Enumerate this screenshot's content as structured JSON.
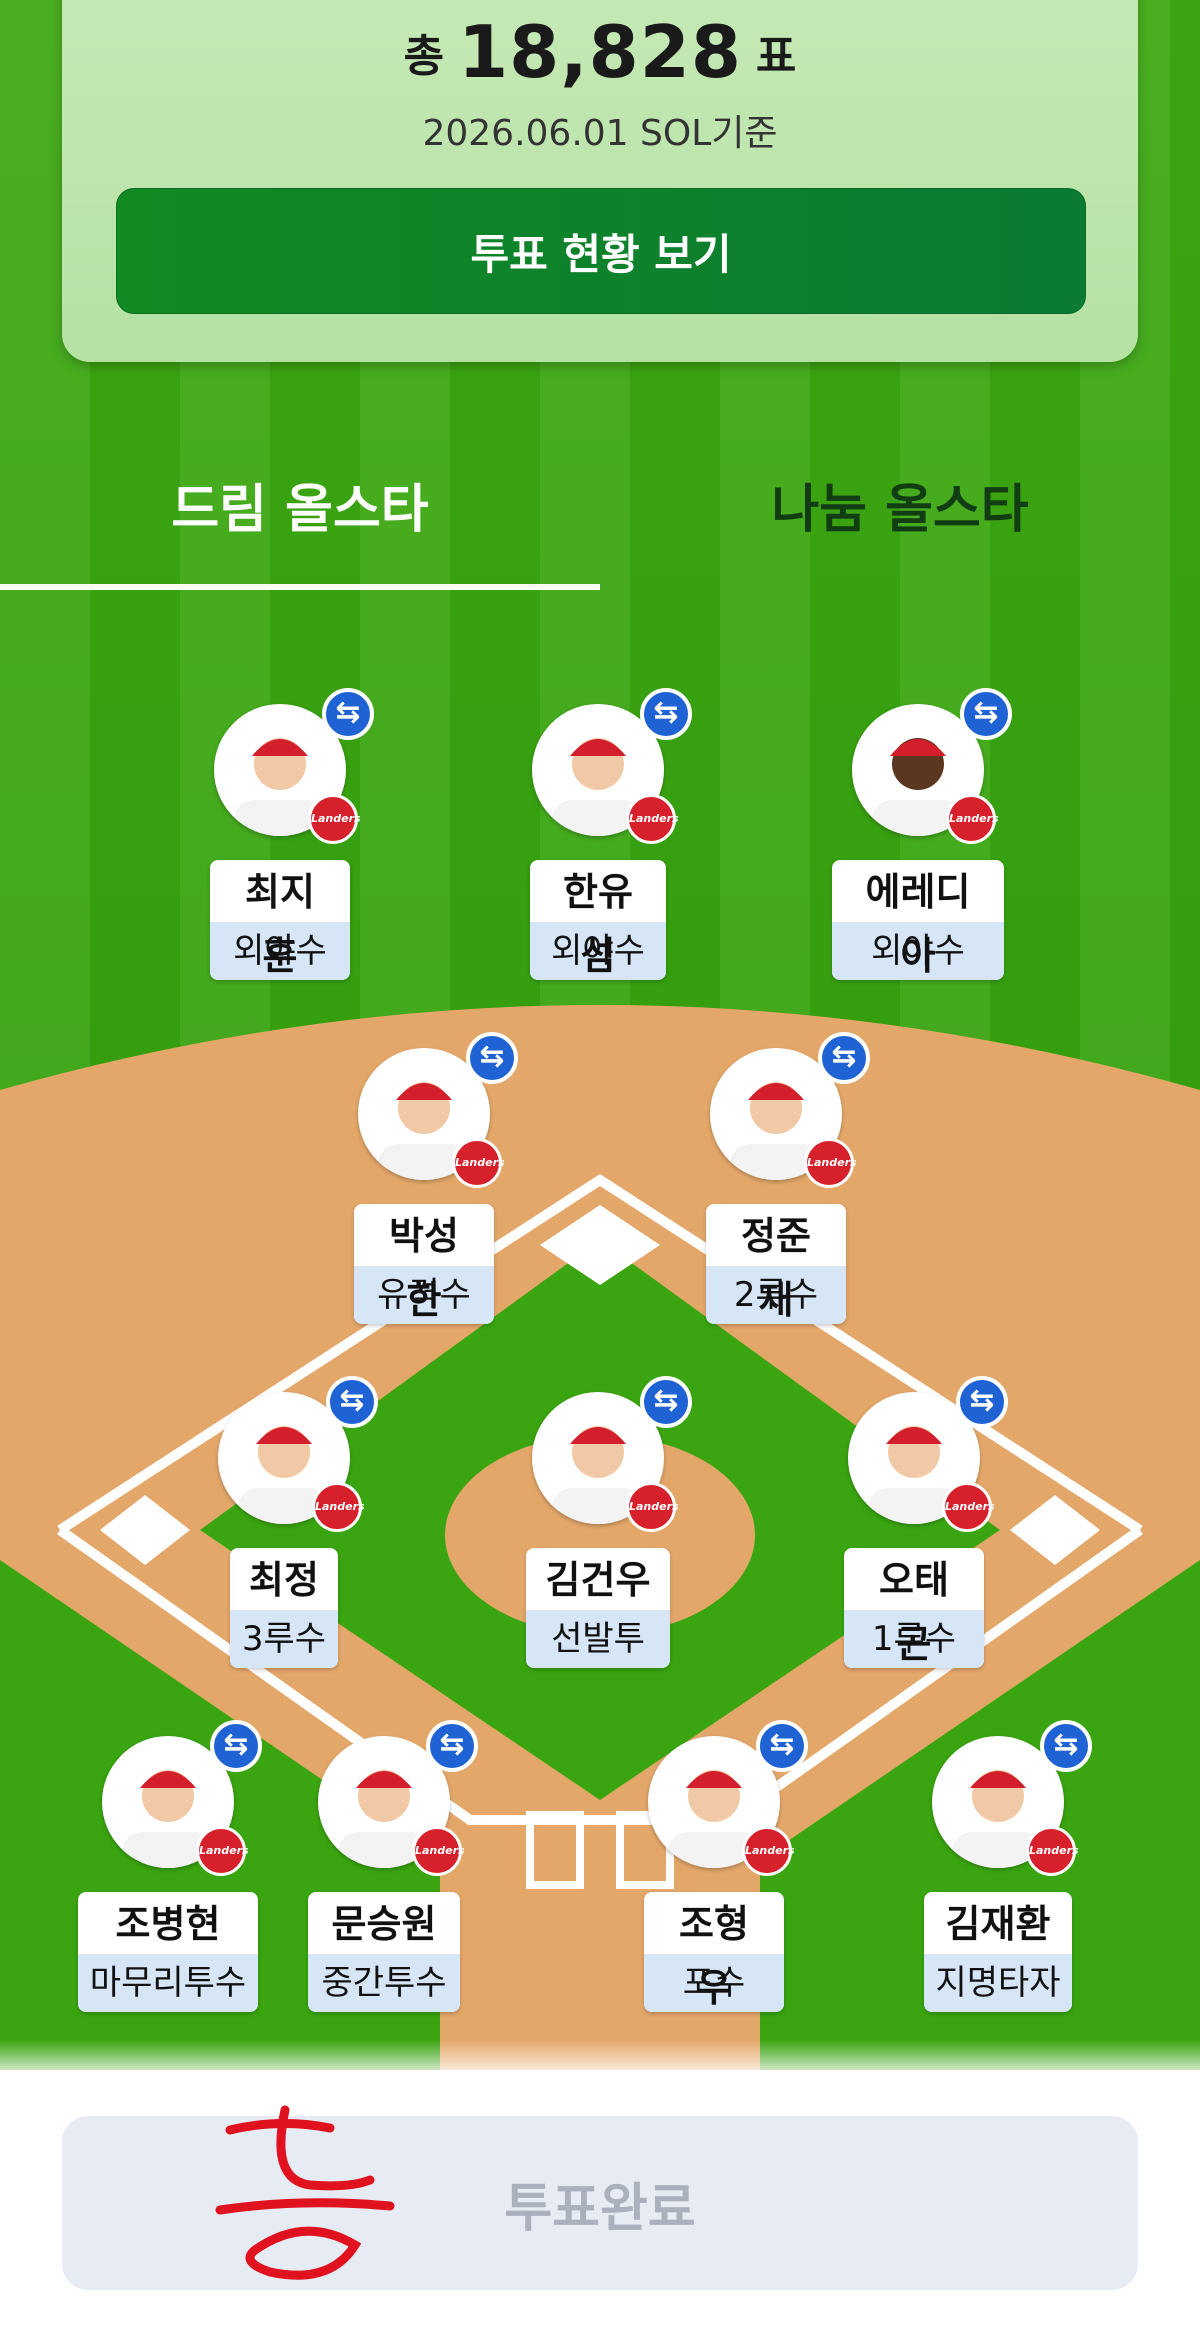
{
  "summary": {
    "total_prefix": "총",
    "total_value": "18,828",
    "total_suffix": "표",
    "basis_date": "2026.06.01 SOL기준",
    "status_button": "투표 현황 보기"
  },
  "tabs": [
    {
      "label": "드림 올스타",
      "active": true
    },
    {
      "label": "나눔 올스타",
      "active": false
    }
  ],
  "colors": {
    "grass": "#3aa510",
    "infield_dirt": "#e4a76a",
    "swap_badge": "#1e62d4",
    "team_red": "#d6202b",
    "position_bg": "#d6e6f7"
  },
  "swap_icon": "⇆",
  "players": [
    {
      "name": "최지훈",
      "position": "외야수",
      "icon": "player-photo"
    },
    {
      "name": "한유섬",
      "position": "외야수",
      "icon": "player-photo"
    },
    {
      "name": "에레디아",
      "position": "외야수",
      "icon": "player-photo"
    },
    {
      "name": "박성한",
      "position": "유격수",
      "icon": "player-photo"
    },
    {
      "name": "정준재",
      "position": "2루수",
      "icon": "player-photo"
    },
    {
      "name": "최정",
      "position": "3루수",
      "icon": "player-photo"
    },
    {
      "name": "김건우",
      "position": "선발투수",
      "icon": "player-photo"
    },
    {
      "name": "오태곤",
      "position": "1루수",
      "icon": "player-photo"
    },
    {
      "name": "조병현",
      "position": "마무리투수",
      "icon": "player-photo"
    },
    {
      "name": "문승원",
      "position": "중간투수",
      "icon": "player-photo"
    },
    {
      "name": "조형우",
      "position": "포수",
      "icon": "player-photo"
    },
    {
      "name": "김재환",
      "position": "지명타자",
      "icon": "player-photo"
    }
  ],
  "team_logo_text": "Landers",
  "complete_button": "투표완료"
}
